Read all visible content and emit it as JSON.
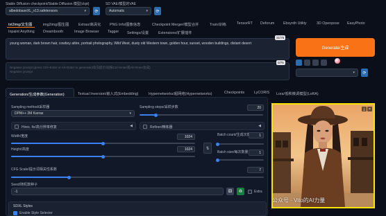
{
  "top": {
    "checkpoint_label": "Stable Diffusion checkpoint/Stable Diffusion 模型(ckpt)",
    "checkpoint_value": "albedobaseXL_v13.safetensors",
    "vae_label": "SD VAE/模型的VAE",
    "vae_value": "Automatic"
  },
  "tabs": [
    {
      "label": "txt2img/文生图"
    },
    {
      "label": "img2img/图生图"
    },
    {
      "label": "Extras/高清化"
    },
    {
      "label": "PNG Info/图像信息"
    },
    {
      "label": "Checkpoint Merger/模型合并"
    },
    {
      "label": "Train/训练"
    },
    {
      "label": "TensorRT"
    },
    {
      "label": "Deforum"
    },
    {
      "label": "Ebsynth Utility"
    },
    {
      "label": "3D Openpose"
    },
    {
      "label": "EasyPhoto"
    },
    {
      "label": "Inpaint Anything"
    },
    {
      "label": "Dreambooth"
    },
    {
      "label": "Image Browser"
    },
    {
      "label": "Tagger"
    },
    {
      "label": "Settings/设置"
    },
    {
      "label": "Extensions/扩展插件"
    }
  ],
  "prompt": {
    "positive": "young woman, dark brown hair, cowboy attire, portrait photography, Wild West, dusty old Western town, golden hour, sunset, wooden buildings, distant desert",
    "positive_counter": "31/75",
    "negative_placeholder": "Negative prompt (press Ctrl+Enter or Alt+Enter to generate)/反向提示词(按Ctrl+Enter或Alt+Enter生成)\nNegative prompt",
    "negative_counter": "0/75"
  },
  "generate_label": "Generate/生成",
  "subtabs": [
    {
      "label": "Generation/生成参数(Generation)"
    },
    {
      "label": "Textual Inversion/嵌入式(Embedding)"
    },
    {
      "label": "Hypernetworks/超网络(Hypernetworks)"
    },
    {
      "label": "Checkpoints"
    },
    {
      "label": "LyCORIS"
    },
    {
      "label": "Lora/低秩微调模型(LoRA)"
    }
  ],
  "params": {
    "sampler_label": "Sampling method/采样器",
    "sampler_value": "DPM++ 2M Karras",
    "steps_label": "Sampling steps/采样步数",
    "steps_value": "20",
    "hires_label": "Hires. fix/高分辨率修复",
    "refiner_label": "Refiner/精炼器",
    "width_label": "Width/宽度",
    "width_value": "1024",
    "height_label": "Height/高度",
    "height_value": "1024",
    "batch_count_label": "Batch count/生成次数",
    "batch_count_value": "1",
    "batch_size_label": "Batch size/每次数量",
    "batch_size_value": "1",
    "cfg_label": "CFG Scale/提示词相关性系数",
    "cfg_value": "7",
    "seed_label": "Seed/随机数种子",
    "seed_value": "-1",
    "extra_label": "Extra",
    "sdxl_styles_label": "SDXL Styles",
    "enable_style_label": "Enable Style Selector"
  },
  "sliders": {
    "steps_fraction": 0.13,
    "width_fraction": 0.5,
    "height_fraction": 0.5,
    "cfg_fraction": 0.23
  },
  "watermark": "公众号 · Vito的AI力量",
  "colors": {
    "generate_orange": "#f97316",
    "accent_blue": "#3b82f6",
    "image_frame_yellow": "#ffe600"
  }
}
